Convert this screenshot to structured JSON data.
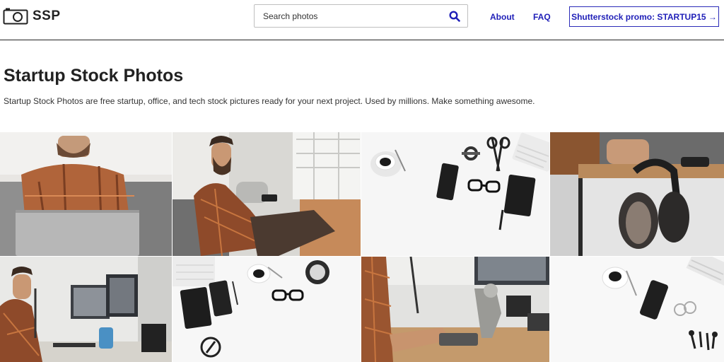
{
  "header": {
    "logo_text": "SSP",
    "logo_icon": "camera-icon",
    "search": {
      "placeholder": "Search photos",
      "value": "",
      "icon": "search-icon"
    },
    "nav": [
      {
        "label": "About"
      },
      {
        "label": "FAQ"
      }
    ],
    "promo_label": "Shutterstock promo: STARTUP15 →"
  },
  "main": {
    "title": "Startup Stock Photos",
    "description": "Startup Stock Photos are free startup, office, and tech stock pictures ready for your next project. Used by millions. Make something awesome."
  },
  "colors": {
    "accent": "#1f1fb8",
    "text": "#222222",
    "header_border": "#222222"
  }
}
